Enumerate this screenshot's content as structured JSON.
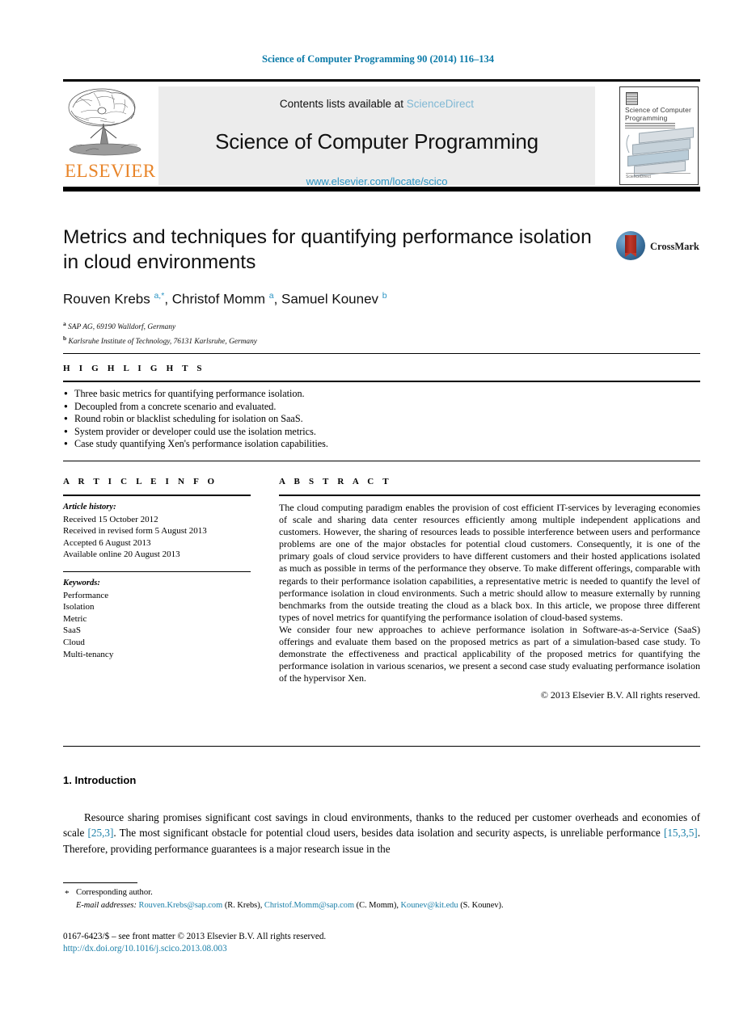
{
  "running_head": "Science of Computer Programming 90 (2014) 116–134",
  "masthead": {
    "contents_prefix": "Contents lists available at",
    "sciencedirect": "ScienceDirect",
    "journal_name": "Science of Computer Programming",
    "journal_url": "www.elsevier.com/locate/scico",
    "publisher_wordmark": "ELSEVIER",
    "cover": {
      "title": "Science of Computer Programming",
      "footer": "ScienceDirect"
    }
  },
  "article": {
    "title": "Metrics and techniques for quantifying performance isolation in cloud environments",
    "authors_html": "Rouven Krebs <sup>a,</sup><sup>*</sup>, Christof Momm <sup>a</sup>, Samuel Kounev <sup>b</sup>",
    "affiliations": [
      {
        "marker": "a",
        "text": "SAP AG, 69190 Walldorf, Germany"
      },
      {
        "marker": "b",
        "text": "Karlsruhe Institute of Technology, 76131 Karlsruhe, Germany"
      }
    ],
    "crossmark_label": "CrossMark"
  },
  "highlights": {
    "label": "H I G H L I G H T S",
    "items": [
      "Three basic metrics for quantifying performance isolation.",
      "Decoupled from a concrete scenario and evaluated.",
      "Round robin or blacklist scheduling for isolation on SaaS.",
      "System provider or developer could use the isolation metrics.",
      "Case study quantifying Xen's performance isolation capabilities."
    ]
  },
  "article_info": {
    "label": "A R T I C L E    I N F O",
    "history_head": "Article history:",
    "history": [
      "Received 15 October 2012",
      "Received in revised form 5 August 2013",
      "Accepted 6 August 2013",
      "Available online 20 August 2013"
    ],
    "keywords_head": "Keywords:",
    "keywords": [
      "Performance",
      "Isolation",
      "Metric",
      "SaaS",
      "Cloud",
      "Multi-tenancy"
    ]
  },
  "abstract": {
    "label": "A B S T R A C T",
    "paragraphs": [
      "The cloud computing paradigm enables the provision of cost efficient IT-services by leveraging economies of scale and sharing data center resources efficiently among multiple independent applications and customers. However, the sharing of resources leads to possible interference between users and performance problems are one of the major obstacles for potential cloud customers. Consequently, it is one of the primary goals of cloud service providers to have different customers and their hosted applications isolated as much as possible in terms of the performance they observe. To make different offerings, comparable with regards to their performance isolation capabilities, a representative metric is needed to quantify the level of performance isolation in cloud environments. Such a metric should allow to measure externally by running benchmarks from the outside treating the cloud as a black box. In this article, we propose three different types of novel metrics for quantifying the performance isolation of cloud-based systems.",
      "We consider four new approaches to achieve performance isolation in Software-as-a-Service (SaaS) offerings and evaluate them based on the proposed metrics as part of a simulation-based case study. To demonstrate the effectiveness and practical applicability of the proposed metrics for quantifying the performance isolation in various scenarios, we present a second case study evaluating performance isolation of the hypervisor Xen."
    ],
    "copyright": "© 2013 Elsevier B.V. All rights reserved."
  },
  "introduction": {
    "heading": "1. Introduction",
    "text_parts": [
      {
        "t": "Resource sharing promises significant cost savings in cloud environments, thanks to the reduced per customer overheads and economies of scale ",
        "cite": false
      },
      {
        "t": "[25,3]",
        "cite": true
      },
      {
        "t": ". The most significant obstacle for potential cloud users, besides data isolation and security aspects, is unreliable performance ",
        "cite": false
      },
      {
        "t": "[15,3,5]",
        "cite": true
      },
      {
        "t": ". Therefore, providing performance guarantees is a major research issue in the",
        "cite": false
      }
    ]
  },
  "footnotes": {
    "corresponding": "Corresponding author.",
    "star": "*",
    "email_label": "E-mail addresses:",
    "emails": [
      {
        "address": "Rouven.Krebs@sap.com",
        "who": "(R. Krebs)"
      },
      {
        "address": "Christof.Momm@sap.com",
        "who": "(C. Momm)"
      },
      {
        "address": "Kounev@kit.edu",
        "who": "(S. Kounev)"
      }
    ],
    "issn_line": "0167-6423/$ – see front matter © 2013 Elsevier B.V. All rights reserved.",
    "doi": "http://dx.doi.org/10.1016/j.scico.2013.08.003"
  },
  "colors": {
    "link_blue": "#1a7fa8",
    "header_blue": "#0b7aa8",
    "sciencedirect_blue": "#7fb8d4",
    "elsevier_orange": "#e8852a",
    "band_gray": "#ececec"
  }
}
